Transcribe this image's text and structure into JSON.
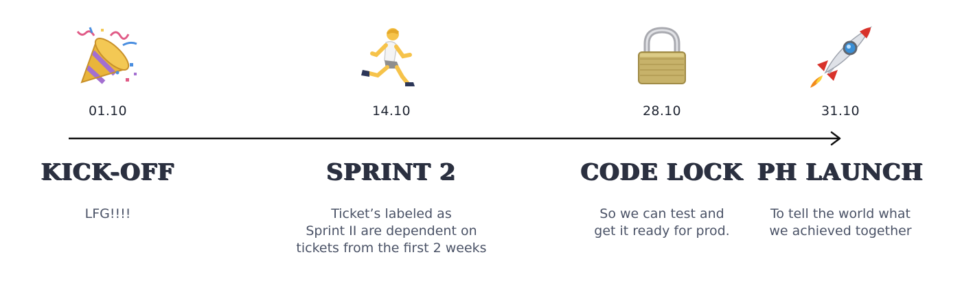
{
  "milestones": [
    {
      "emoji": "party-popper",
      "date": "01.10",
      "title": "KICK-OFF",
      "description": "LFG!!!!"
    },
    {
      "emoji": "person-running",
      "date": "14.10",
      "title": "SPRINT 2",
      "description": "Ticket’s labeled as\nSprint II are dependent on\ntickets from the first 2 weeks"
    },
    {
      "emoji": "lock",
      "date": "28.10",
      "title": "CODE LOCK",
      "description": "So we can test and\nget it ready for prod."
    },
    {
      "emoji": "rocket",
      "date": "31.10",
      "title": "PH LAUNCH",
      "description": "To tell the world what\nwe achieved together"
    }
  ],
  "colors": {
    "axis": "#111111",
    "title": "#2b3040",
    "description": "#4a5266"
  }
}
